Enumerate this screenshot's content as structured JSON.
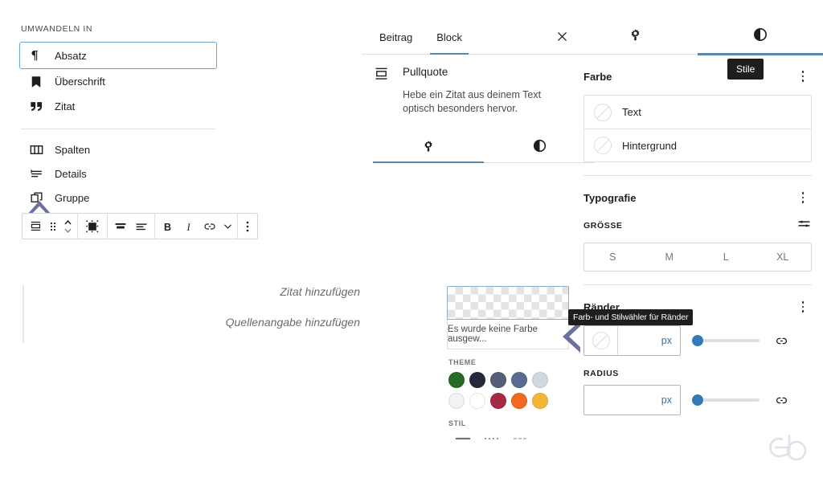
{
  "transform_menu": {
    "caption": "UMWANDELN IN",
    "group1": [
      {
        "label": "Absatz",
        "icon": "paragraph-pilcrow-icon",
        "selected": true
      },
      {
        "label": "Überschrift",
        "icon": "heading-bookmark-icon",
        "selected": false
      },
      {
        "label": "Zitat",
        "icon": "quote-marks-icon",
        "selected": false
      }
    ],
    "group2": [
      {
        "label": "Spalten",
        "icon": "columns-icon",
        "selected": false
      },
      {
        "label": "Details",
        "icon": "details-list-icon",
        "selected": false
      },
      {
        "label": "Gruppe",
        "icon": "group-stack-icon",
        "selected": false
      }
    ]
  },
  "block_toolbar": {
    "buttons": [
      {
        "name": "block-type-pullquote-icon",
        "label": "Pullquote"
      },
      {
        "name": "drag-handle-icon",
        "label": "Ziehen"
      },
      {
        "name": "move-up-down-icon",
        "label": "Verschieben"
      },
      {
        "name": "align-block-icon",
        "label": "Ausrichtung ändern"
      },
      {
        "name": "align-text-center-icon",
        "label": "Textausrichtung"
      },
      {
        "name": "align-text-left-icon",
        "label": "Textausrichtung links"
      },
      {
        "name": "bold-icon",
        "label": "B"
      },
      {
        "name": "italic-icon",
        "label": "I"
      },
      {
        "name": "link-icon",
        "label": "Link"
      },
      {
        "name": "chevron-down-icon",
        "label": "Mehr Formatierung"
      },
      {
        "name": "options-kebab-icon",
        "label": "Optionen"
      }
    ]
  },
  "canvas": {
    "quote_placeholder": "Zitat hinzufügen",
    "citation_placeholder": "Quellenangabe hinzufügen"
  },
  "sidebar": {
    "tabs": [
      {
        "label": "Beitrag",
        "active": false
      },
      {
        "label": "Block",
        "active": true
      }
    ],
    "close_icon": "close-icon",
    "inspector_tabs": [
      {
        "icon": "settings-gear-icon",
        "active": false,
        "tooltip": "Einstellungen"
      },
      {
        "icon": "styles-contrast-icon",
        "active": true,
        "tooltip": "Stile"
      }
    ]
  },
  "block_card": {
    "icon": "pullquote-block-icon",
    "title": "Pullquote",
    "description": "Hebe ein Zitat aus deinem Text optisch besonders hervor.",
    "tabs": [
      {
        "icon": "settings-gear-icon",
        "active": true
      },
      {
        "icon": "styles-contrast-icon",
        "active": false
      }
    ]
  },
  "inspector": {
    "color": {
      "title": "Farbe",
      "kebab": "options-kebab-icon",
      "rows": [
        {
          "label": "Text",
          "swatch": "no-color-icon"
        },
        {
          "label": "Hintergrund",
          "swatch": "no-color-icon"
        }
      ]
    },
    "typography": {
      "title": "Typografie",
      "kebab": "options-kebab-icon",
      "size_label": "GRÖSSE",
      "size_toggle_icon": "custom-size-sliders-icon",
      "sizes": [
        "S",
        "M",
        "L",
        "XL"
      ],
      "selected_size": null
    },
    "borders": {
      "title": "Ränder",
      "kebab": "options-kebab-icon",
      "width_unit": "px",
      "width_value": "",
      "width_swatch": "no-color-icon",
      "link_icon": "link-sides-icon",
      "radius_label": "RADIUS",
      "radius_unit": "px",
      "radius_value": "",
      "radius_link_icon": "link-corners-icon"
    }
  },
  "color_picker": {
    "no_color_text": "Es wurde keine Farbe ausgew...",
    "theme_label": "THEME",
    "theme_colors": [
      "#256b23",
      "#252939",
      "#555d77",
      "#5b6a91",
      "#d3d8e0",
      "#f1f2f3",
      "#ffffff",
      "#a62946",
      "#f26a21",
      "#f4b53b"
    ],
    "style_label": "STIL",
    "styles": [
      "solid",
      "dotted",
      "dashed"
    ]
  },
  "tooltips": {
    "stile": "Stile",
    "raender": "Farb- und Stilwähler für Ränder"
  },
  "watermark": {
    "text": "eb"
  },
  "colors": {
    "accent": "#5b87ad",
    "slider": "#337ab7",
    "cursor_arrow": "#6b70a0",
    "link_text": "#3a6f9a"
  }
}
